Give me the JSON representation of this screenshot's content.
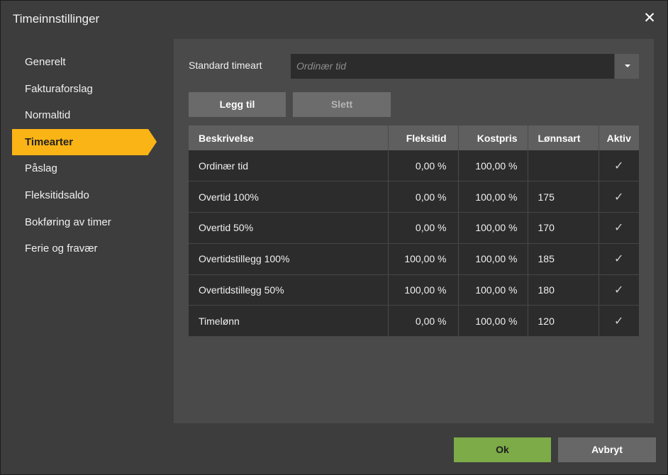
{
  "dialog": {
    "title": "Timeinnstillinger",
    "close_icon": "close-icon"
  },
  "sidebar": {
    "items": [
      {
        "label": "Generelt",
        "active": false
      },
      {
        "label": "Fakturaforslag",
        "active": false
      },
      {
        "label": "Normaltid",
        "active": false
      },
      {
        "label": "Timearter",
        "active": true
      },
      {
        "label": "Påslag",
        "active": false
      },
      {
        "label": "Fleksitidsaldo",
        "active": false
      },
      {
        "label": "Bokføring av timer",
        "active": false
      },
      {
        "label": "Ferie og fravær",
        "active": false
      }
    ]
  },
  "form": {
    "standard_label": "Standard timeart",
    "standard_placeholder": "Ordinær tid",
    "add_label": "Legg til",
    "delete_label": "Slett"
  },
  "table": {
    "headers": [
      "Beskrivelse",
      "Fleksitid",
      "Kostpris",
      "Lønnsart",
      "Aktiv"
    ],
    "rows": [
      [
        "Ordinær tid",
        "0,00 %",
        "100,00 %",
        "",
        "✓"
      ],
      [
        "Overtid 100%",
        "0,00 %",
        "100,00 %",
        "175",
        "✓"
      ],
      [
        "Overtid 50%",
        "0,00 %",
        "100,00 %",
        "170",
        "✓"
      ],
      [
        "Overtidstillegg 100%",
        "100,00 %",
        "100,00 %",
        "185",
        "✓"
      ],
      [
        "Overtidstillegg 50%",
        "100,00 %",
        "100,00 %",
        "180",
        "✓"
      ],
      [
        "Timelønn",
        "0,00 %",
        "100,00 %",
        "120",
        "✓"
      ]
    ]
  },
  "footer": {
    "ok_label": "Ok",
    "cancel_label": "Avbryt"
  },
  "colors": {
    "accent": "#fbb416",
    "ok_button": "#7cab48",
    "background": "#3d3d3d"
  }
}
